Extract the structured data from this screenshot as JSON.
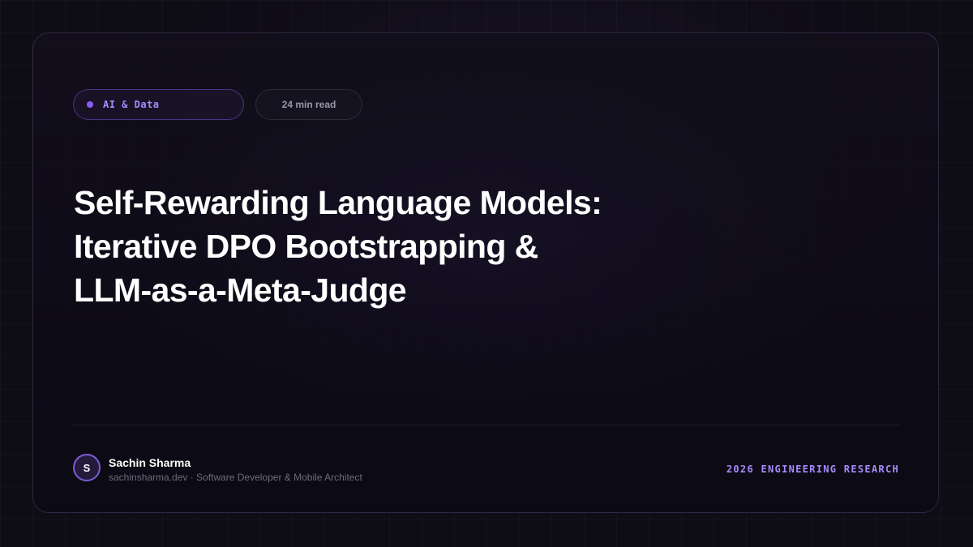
{
  "category": {
    "label": "AI & Data",
    "dot_color": "#8b5cf6"
  },
  "read_time": "24 min read",
  "title": {
    "line1": "Self-Rewarding Language Models:",
    "line2": "Iterative DPO Bootstrapping &",
    "line3": "LLM-as-a-Meta-Judge"
  },
  "author": {
    "initial": "S",
    "name": "Sachin Sharma",
    "meta": "sachinsharma.dev · Software Developer & Mobile Architect"
  },
  "footer_tag": "2026 ENGINEERING RESEARCH",
  "colors": {
    "accent": "#8b5cf6",
    "accent_text": "#a78bfa",
    "background": "#0e0c15"
  }
}
